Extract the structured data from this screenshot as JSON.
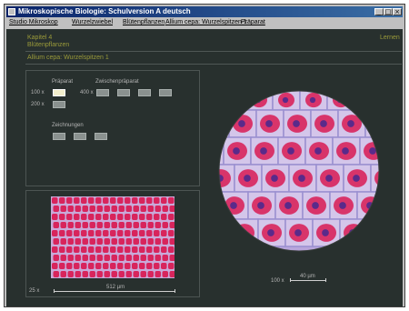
{
  "window": {
    "title": "Mikroskopische Biologie: Schulversion A deutsch",
    "controls": [
      "_",
      "□",
      "×"
    ]
  },
  "menu": [
    "Studio Mikroskop",
    "Wurzelzwiebel",
    "Blütenpflanzen",
    "Allium cepa: Wurzelspitzen 1",
    "Präparat"
  ],
  "header": {
    "chapter": "Kapitel 4",
    "chapter_title": "Blütenpflanzen",
    "subtitle": "Allium cepa: Wurzelspitzen 1",
    "action": "Lernen"
  },
  "controls": {
    "preparat_label": "Präparat",
    "zwischen_label": "Zwischenpräparat",
    "zeichnungen_label": "Zeichnungen",
    "mag_100": "100 x",
    "mag_400": "400 x",
    "mag_200": "200 x"
  },
  "thumbnail": {
    "mag": "25 x",
    "scale": "512 µm"
  },
  "micrograph": {
    "mag": "100 x",
    "scale": "40 µm"
  },
  "colors": {
    "background": "#28302e",
    "accent": "#9a9a3a",
    "cell_stain": "#d8245c",
    "cell_wall": "#9a8fd0"
  }
}
